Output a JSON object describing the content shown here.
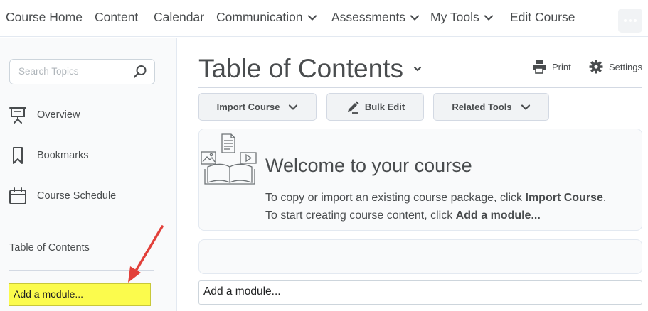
{
  "nav": {
    "items": [
      {
        "label": "Course Home"
      },
      {
        "label": "Content"
      },
      {
        "label": "Calendar"
      },
      {
        "label": "Communication"
      },
      {
        "label": "Assessments"
      },
      {
        "label": "My Tools"
      },
      {
        "label": "Edit Course"
      }
    ],
    "more_icon": "ellipsis-icon"
  },
  "sidebar": {
    "search_placeholder": "Search Topics",
    "items": [
      {
        "label": "Overview",
        "icon": "presentation-board-icon"
      },
      {
        "label": "Bookmarks",
        "icon": "bookmark-icon"
      },
      {
        "label": "Course Schedule",
        "icon": "calendar-icon"
      }
    ],
    "toc_label": "Table of Contents",
    "add_module": "Add a module...",
    "highlight_color": "#fbfb4d",
    "annotation_arrow_color": "#e2403a"
  },
  "main": {
    "title": "Table of Contents",
    "print_label": "Print",
    "settings_label": "Settings",
    "buttons": {
      "import": "Import Course",
      "bulk": "Bulk Edit",
      "related": "Related Tools"
    },
    "welcome": {
      "heading": "Welcome to your course",
      "line1_prefix": "To copy or import an existing course package, click ",
      "line1_bold": "Import Course",
      "line1_suffix": ".",
      "line2_prefix": "To start creating course content, click ",
      "line2_bold": "Add a module..."
    },
    "add_module": "Add a module..."
  }
}
